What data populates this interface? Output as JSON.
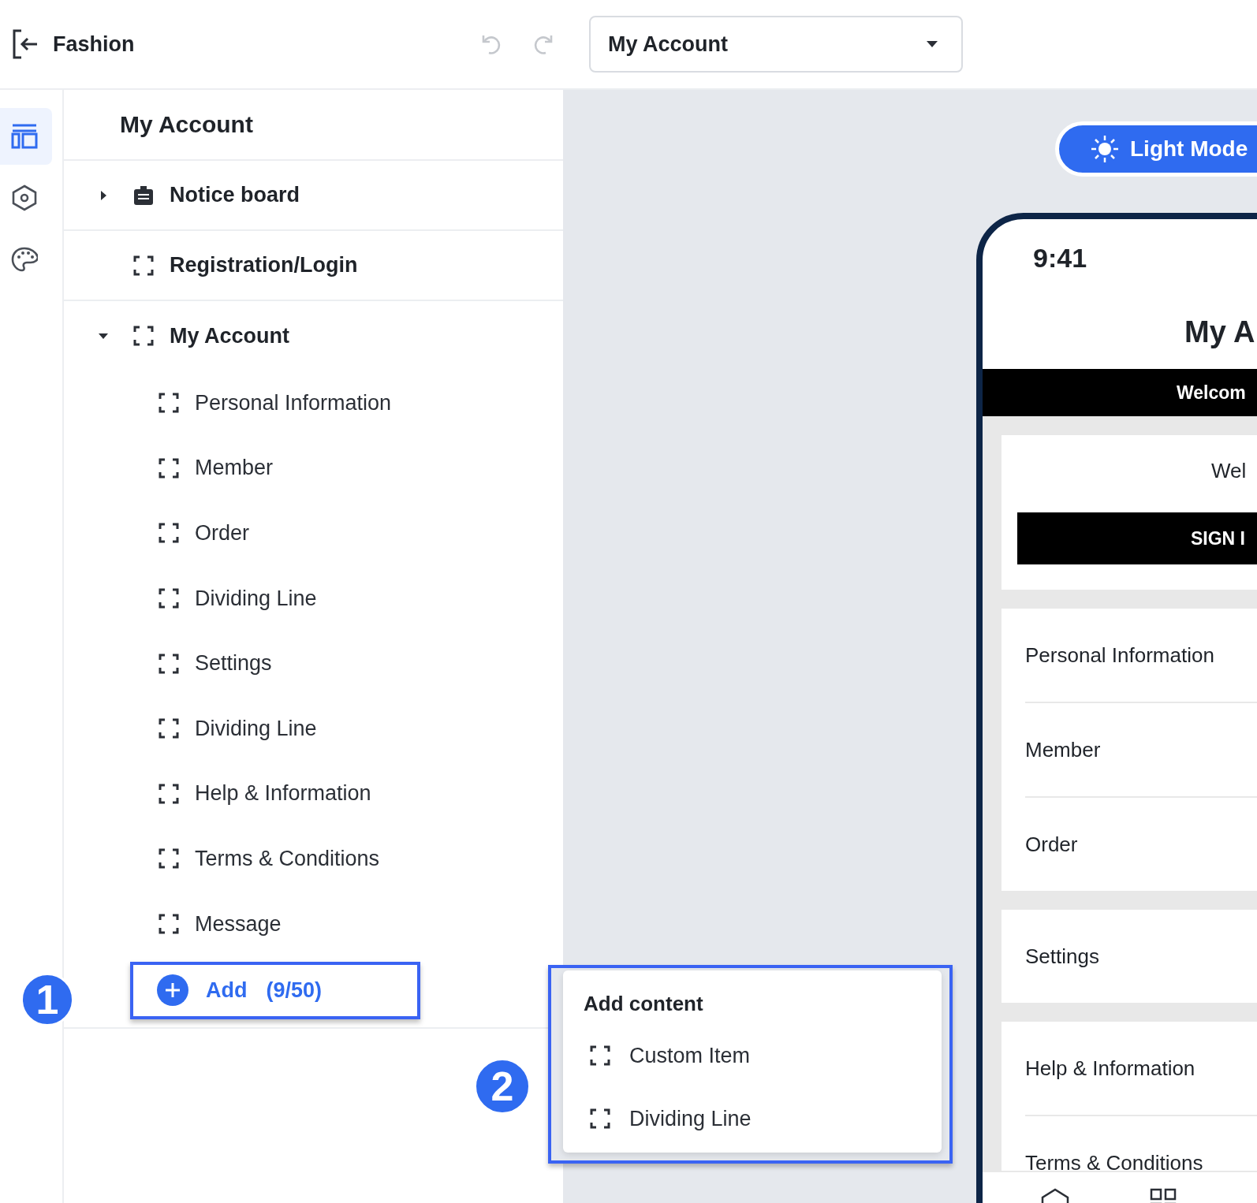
{
  "header": {
    "title": "Fashion",
    "undo_disabled": true,
    "redo_disabled": true,
    "page_select": {
      "value": "My Account"
    }
  },
  "rail": [
    {
      "selected": true
    },
    {
      "selected": false
    },
    {
      "selected": false
    }
  ],
  "tree": {
    "title": "My Account",
    "items": [
      {
        "label": "Notice board",
        "kind": "board",
        "expanded": false
      },
      {
        "label": "Registration/Login",
        "kind": "frame"
      },
      {
        "label": "My Account",
        "kind": "frame",
        "expanded": true,
        "children": [
          {
            "label": "Personal Information"
          },
          {
            "label": "Member"
          },
          {
            "label": "Order"
          },
          {
            "label": "Dividing Line"
          },
          {
            "label": "Settings"
          },
          {
            "label": "Dividing Line"
          },
          {
            "label": "Help & Information"
          },
          {
            "label": "Terms & Conditions"
          },
          {
            "label": "Message"
          }
        ]
      }
    ],
    "add_button": {
      "label": "Add",
      "count": "(9/50)"
    }
  },
  "callouts": [
    "1",
    "2"
  ],
  "add_menu": {
    "title": "Add content",
    "items": [
      "Custom Item",
      "Dividing Line"
    ]
  },
  "preview": {
    "mode_button": "Light Mode",
    "status_time": "9:41",
    "page_title": "My A",
    "banner": "Welcom",
    "card": {
      "text": "Wel",
      "button": "SIGN I"
    },
    "menu_groups": [
      [
        "Personal Information",
        "Member",
        "Order"
      ],
      [
        "Settings"
      ],
      [
        "Help & Information",
        "Terms & Conditions"
      ]
    ]
  }
}
